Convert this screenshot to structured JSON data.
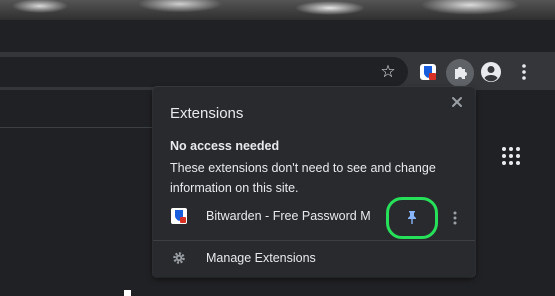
{
  "browser": {
    "toolbar_icons": [
      "star-icon",
      "bitwarden-icon",
      "puzzle-icon",
      "profile-icon",
      "more-vert-icon"
    ],
    "apps_icon": "apps-grid-icon",
    "partial_text": "s"
  },
  "extensions_popup": {
    "title": "Extensions",
    "section_heading": "No access needed",
    "section_description": "These extensions don't need to see and change information on this site.",
    "extensions": [
      {
        "name": "Bitwarden - Free Password M...",
        "icon": "bitwarden-icon",
        "pinned": true
      }
    ],
    "manage_label": "Manage Extensions",
    "highlight_color": "#27e05a",
    "pin_color": "#8ab4f8"
  }
}
